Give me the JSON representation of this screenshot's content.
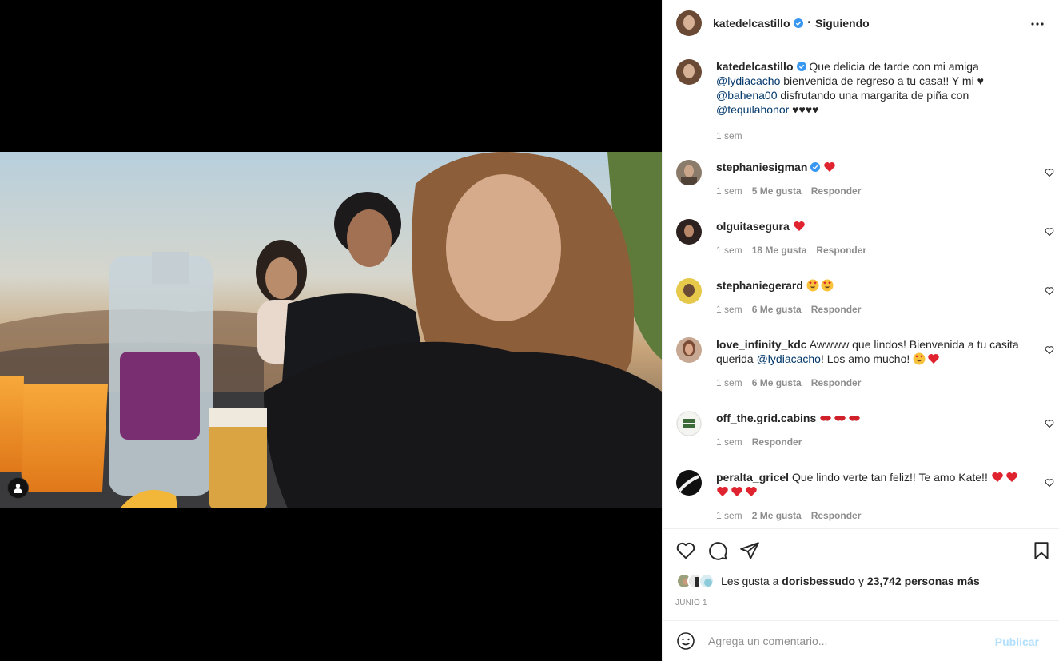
{
  "post": {
    "author": "katedelcastillo",
    "follow_status": "Siguiendo",
    "caption": {
      "intro": "Que delicia de tarde con mi amiga",
      "mention1": "@lydiacacho",
      "mid1": "bienvenida de regreso a tu casa!! Y mi ♥",
      "mention2": "@bahena00",
      "mid2": "disfrutando una margarita de piña con",
      "mention3": "@tequilahonor",
      "end": "♥♥♥♥"
    },
    "caption_time": "1 sem"
  },
  "comments": [
    {
      "user": "stephaniesigman",
      "time": "1 sem",
      "likes": "5 Me gusta",
      "reply": "Responder"
    },
    {
      "user": "olguitasegura",
      "time": "1 sem",
      "likes": "18 Me gusta",
      "reply": "Responder"
    },
    {
      "user": "stephaniegerard",
      "time": "1 sem",
      "likes": "6 Me gusta",
      "reply": "Responder"
    },
    {
      "user": "love_infinity_kdc",
      "text1": "Awwww que lindos! Bienvenida a tu casita querida",
      "mention": "@lydiacacho",
      "text2": "! Los amo mucho!",
      "time": "1 sem",
      "likes": "6 Me gusta",
      "reply": "Responder"
    },
    {
      "user": "off_the.grid.cabins",
      "time": "1 sem",
      "reply": "Responder"
    },
    {
      "user": "peralta_gricel",
      "text1": "Que lindo verte tan feliz!! Te amo Kate!!",
      "time": "1 sem",
      "likes": "2 Me gusta",
      "reply": "Responder"
    }
  ],
  "likes_line": {
    "prefix": "Les gusta a",
    "user": "dorisbessudo",
    "joiner": "y",
    "others": "23,742 personas más"
  },
  "date": "JUNIO 1",
  "add_comment": {
    "placeholder": "Agrega un comentario...",
    "publish": "Publicar"
  },
  "colors": {
    "link": "#00376b",
    "verified": "#3897f0",
    "heart": "#ed4956",
    "publish_disabled": "#b2dffc"
  },
  "icons": [
    "more-icon",
    "verified-icon",
    "heart-icon",
    "comment-icon",
    "share-icon",
    "save-icon",
    "emoji-icon",
    "user-tag-icon"
  ]
}
